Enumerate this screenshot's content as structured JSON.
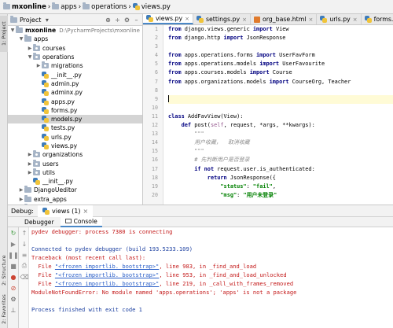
{
  "breadcrumb": {
    "items": [
      "mxonline",
      "apps",
      "operations",
      "views.py"
    ]
  },
  "left_strip": {
    "tabs": [
      "1: Project",
      "2: Structure",
      "2: Favorites"
    ]
  },
  "project_panel": {
    "title": "Project",
    "tree": [
      {
        "label": "mxonline",
        "path": "D:\\PycharmProjects\\mxonline",
        "icon": "folder-icon",
        "arrow": "open",
        "indent": 0
      },
      {
        "label": "apps",
        "icon": "folder-icon",
        "arrow": "open",
        "indent": 1
      },
      {
        "label": "courses",
        "icon": "package-icon",
        "arrow": "closed",
        "indent": 2
      },
      {
        "label": "operations",
        "icon": "package-icon",
        "arrow": "open",
        "indent": 2
      },
      {
        "label": "migrations",
        "icon": "package-icon",
        "arrow": "closed",
        "indent": 3
      },
      {
        "label": "__init__.py",
        "icon": "python-file-icon",
        "arrow": "none",
        "indent": 3
      },
      {
        "label": "admin.py",
        "icon": "python-file-icon",
        "arrow": "none",
        "indent": 3
      },
      {
        "label": "adminx.py",
        "icon": "python-file-icon",
        "arrow": "none",
        "indent": 3
      },
      {
        "label": "apps.py",
        "icon": "python-file-icon",
        "arrow": "none",
        "indent": 3
      },
      {
        "label": "forms.py",
        "icon": "python-file-icon",
        "arrow": "none",
        "indent": 3
      },
      {
        "label": "models.py",
        "icon": "python-file-icon",
        "arrow": "none",
        "indent": 3,
        "selected": true
      },
      {
        "label": "tests.py",
        "icon": "python-file-icon",
        "arrow": "none",
        "indent": 3
      },
      {
        "label": "urls.py",
        "icon": "python-file-icon",
        "arrow": "none",
        "indent": 3
      },
      {
        "label": "views.py",
        "icon": "python-file-icon",
        "arrow": "none",
        "indent": 3
      },
      {
        "label": "organizations",
        "icon": "package-icon",
        "arrow": "closed",
        "indent": 2
      },
      {
        "label": "users",
        "icon": "package-icon",
        "arrow": "closed",
        "indent": 2
      },
      {
        "label": "utils",
        "icon": "package-icon",
        "arrow": "closed",
        "indent": 2
      },
      {
        "label": "__init__.py",
        "icon": "python-file-icon",
        "arrow": "none",
        "indent": 2
      },
      {
        "label": "DjangoUeditor",
        "icon": "folder-icon",
        "arrow": "closed",
        "indent": 1
      },
      {
        "label": "extra_apps",
        "icon": "folder-icon",
        "arrow": "closed",
        "indent": 1
      },
      {
        "label": "...",
        "icon": "folder-icon",
        "arrow": "closed",
        "indent": 1
      }
    ]
  },
  "editor": {
    "tabs": [
      {
        "label": "views.py",
        "icon": "python-file-icon",
        "active": true
      },
      {
        "label": "settings.py",
        "icon": "python-file-icon",
        "active": false
      },
      {
        "label": "org_base.html",
        "icon": "html-file-icon",
        "active": false
      },
      {
        "label": "urls.py",
        "icon": "python-file-icon",
        "active": false
      },
      {
        "label": "forms.py",
        "icon": "python-file-icon",
        "active": false
      },
      {
        "label": "mo",
        "icon": "python-file-icon",
        "active": false
      }
    ],
    "line_numbers": [
      "1",
      "2",
      "3",
      "4",
      "5",
      "6",
      "7",
      "8",
      "9",
      "10",
      "11",
      "12",
      "13",
      "14",
      "15",
      "16",
      "17",
      "18",
      "19",
      "20"
    ],
    "current_line": 9,
    "code_lines": [
      [
        {
          "t": "kw",
          "v": "from"
        },
        {
          "t": "n",
          "v": " django.views.generic "
        },
        {
          "t": "kw",
          "v": "import"
        },
        {
          "t": "n",
          "v": " View"
        }
      ],
      [
        {
          "t": "kw",
          "v": "from"
        },
        {
          "t": "n",
          "v": " django.http "
        },
        {
          "t": "kw",
          "v": "import"
        },
        {
          "t": "n",
          "v": " JsonResponse"
        }
      ],
      [],
      [
        {
          "t": "kw",
          "v": "from"
        },
        {
          "t": "n",
          "v": " apps.operations.forms "
        },
        {
          "t": "kw",
          "v": "import"
        },
        {
          "t": "n",
          "v": " UserFavForm"
        }
      ],
      [
        {
          "t": "kw",
          "v": "from"
        },
        {
          "t": "n",
          "v": " apps.operations.models "
        },
        {
          "t": "kw",
          "v": "import"
        },
        {
          "t": "n",
          "v": " UserFavourite"
        }
      ],
      [
        {
          "t": "kw",
          "v": "from"
        },
        {
          "t": "n",
          "v": " apps.courses.models "
        },
        {
          "t": "kw",
          "v": "import"
        },
        {
          "t": "n",
          "v": " Course"
        }
      ],
      [
        {
          "t": "kw",
          "v": "from"
        },
        {
          "t": "n",
          "v": " apps.organizations.models "
        },
        {
          "t": "kw",
          "v": "import"
        },
        {
          "t": "n",
          "v": " CourseOrg, Teacher"
        }
      ],
      [],
      [],
      [],
      [
        {
          "t": "kw",
          "v": "class"
        },
        {
          "t": "n",
          "v": " AddFavView(View):"
        }
      ],
      [
        {
          "t": "n",
          "v": "    "
        },
        {
          "t": "kw",
          "v": "def"
        },
        {
          "t": "n",
          "v": " post("
        },
        {
          "t": "self",
          "v": "self"
        },
        {
          "t": "n",
          "v": ", request, *args, **kwargs):"
        }
      ],
      [
        {
          "t": "cmt",
          "v": "        \"\"\""
        }
      ],
      [
        {
          "t": "cmt",
          "v": "        用户收藏，  取消收藏"
        }
      ],
      [
        {
          "t": "cmt",
          "v": "        \"\"\""
        }
      ],
      [
        {
          "t": "cmt",
          "v": "        # 先判断用户是否登录"
        }
      ],
      [
        {
          "t": "n",
          "v": "        "
        },
        {
          "t": "kw",
          "v": "if not"
        },
        {
          "t": "n",
          "v": " request.user.is_authenticated:"
        }
      ],
      [
        {
          "t": "n",
          "v": "            "
        },
        {
          "t": "kw",
          "v": "return"
        },
        {
          "t": "n",
          "v": " JsonResponse({"
        }
      ],
      [
        {
          "t": "n",
          "v": "                "
        },
        {
          "t": "str",
          "v": "\"status\""
        },
        {
          "t": "n",
          "v": ": "
        },
        {
          "t": "str",
          "v": "\"fail\""
        },
        {
          "t": "n",
          "v": ","
        }
      ],
      [
        {
          "t": "n",
          "v": "                "
        },
        {
          "t": "str",
          "v": "\"msg\""
        },
        {
          "t": "n",
          "v": ": "
        },
        {
          "t": "str",
          "v": "\"用户未登录\""
        }
      ]
    ]
  },
  "debug": {
    "title": "Debug:",
    "session_tab": "views (1)",
    "tabs": [
      "Debugger",
      "Console"
    ],
    "active_tab": "Console",
    "console": [
      {
        "style": "err",
        "text": "pydev debugger: process 7380 is connecting"
      },
      {
        "style": "blank",
        "text": ""
      },
      {
        "style": "info",
        "text": "Connected to pydev debugger (build 193.5233.109)"
      },
      {
        "style": "err",
        "text": "Traceback (most recent call last):"
      },
      {
        "style": "err-link",
        "prefix": "  File ",
        "link": "\"<frozen importlib._bootstrap>\"",
        "suffix": ", line 983, in _find_and_load"
      },
      {
        "style": "err-link",
        "prefix": "  File ",
        "link": "\"<frozen importlib._bootstrap>\"",
        "suffix": ", line 953, in _find_and_load_unlocked"
      },
      {
        "style": "err-link",
        "prefix": "  File ",
        "link": "\"<frozen importlib._bootstrap>\"",
        "suffix": ", line 219, in _call_with_frames_removed"
      },
      {
        "style": "err",
        "text": "ModuleNotFoundError: No module named 'apps.operations'; 'apps' is not a package"
      },
      {
        "style": "blank",
        "text": ""
      },
      {
        "style": "info",
        "text": "Process finished with exit code 1"
      }
    ]
  }
}
